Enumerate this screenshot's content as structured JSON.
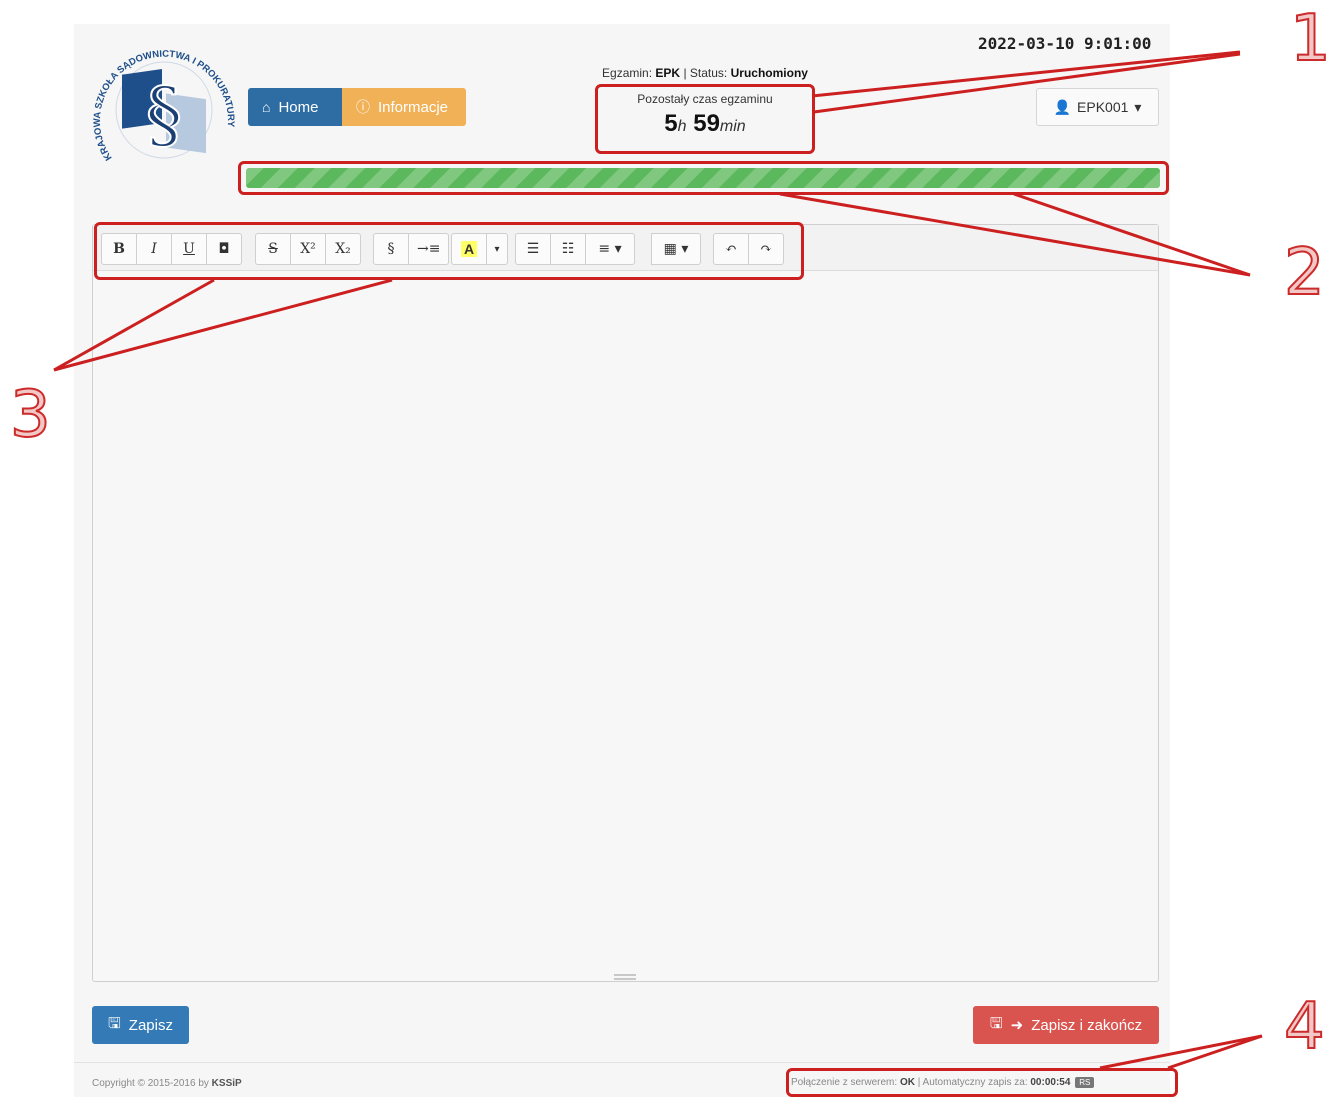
{
  "header": {
    "datetime": "2022-03-10 9:01:00",
    "nav": {
      "home_label": "Home",
      "info_label": "Informacje"
    },
    "exam_label": "Egzamin:",
    "exam_code": "EPK",
    "status_label": "| Status:",
    "status_value": "Uruchomiony",
    "timer": {
      "label": "Pozostały czas egzaminu",
      "hours": "5",
      "hours_unit": "h",
      "minutes": "59",
      "minutes_unit": "min"
    },
    "user": "EPK001",
    "progress": 1.0
  },
  "logo": {
    "text": "KRAJOWA SZKOŁA SĄDOWNICTWA I PROKURATURY"
  },
  "toolbar": {
    "groups": [
      [
        "B",
        "I",
        "U",
        "◘"
      ],
      [
        "S",
        "X²",
        "X₂"
      ],
      [
        "§",
        "→≡"
      ],
      [
        "A",
        "▾"
      ],
      [
        "☰",
        "☷",
        "≡ ▾"
      ],
      [
        "▦ ▾"
      ],
      [
        "↶",
        "↷"
      ]
    ]
  },
  "buttons": {
    "save": "Zapisz",
    "finish": "Zapisz i zakończ"
  },
  "footer": {
    "copyright_prefix": "Copyright © 2015-2016 by",
    "copyright_brand": "KSSiP",
    "conn_label": "Połączenie z serwerem:",
    "conn_value": "OK",
    "autosave_label": "| Automatyczny zapis za:",
    "autosave_value": "00:00:54",
    "badge": "RS"
  },
  "annotations": [
    "1",
    "2",
    "3",
    "4"
  ],
  "colors": {
    "annotation": "#cc1f1f",
    "primary": "#337ab7",
    "warning": "#f0ad4e",
    "danger": "#d9534f",
    "success": "#5cb85c"
  }
}
